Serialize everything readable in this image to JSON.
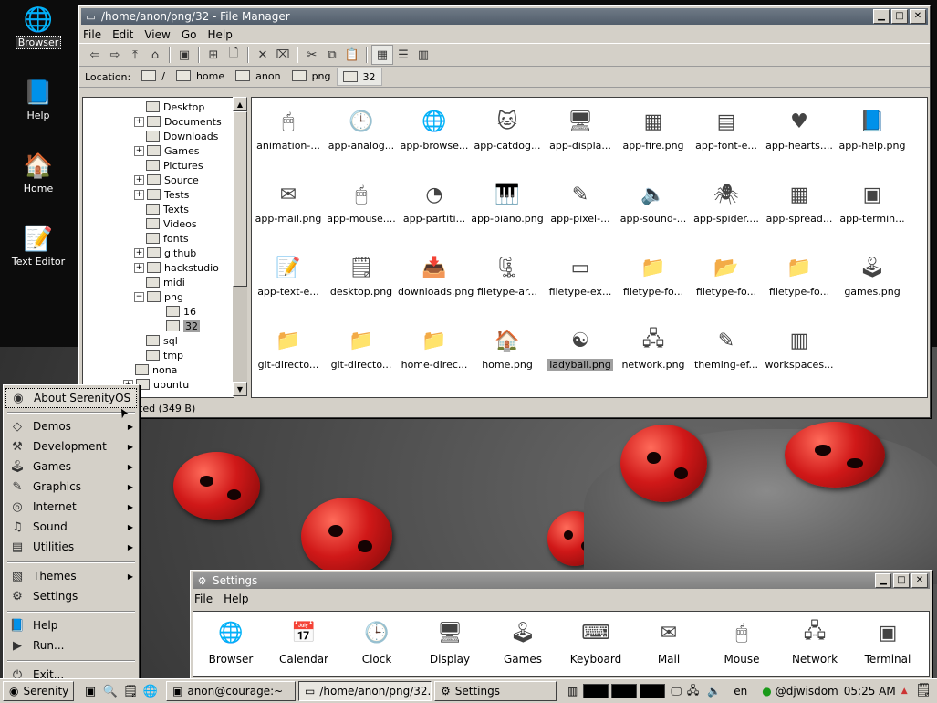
{
  "desktop": {
    "icons": [
      {
        "label": "Browser",
        "icon": "browser-icon",
        "glyph": "🌐",
        "selected": true
      },
      {
        "label": "Help",
        "icon": "help-icon",
        "glyph": "📘",
        "selected": false
      },
      {
        "label": "Home",
        "icon": "home-icon",
        "glyph": "🏠",
        "selected": false
      },
      {
        "label": "Text Editor",
        "icon": "text-editor-icon",
        "glyph": "📝",
        "selected": false
      }
    ]
  },
  "file_manager": {
    "title": "/home/anon/png/32 - File Manager",
    "menu": [
      "File",
      "Edit",
      "View",
      "Go",
      "Help"
    ],
    "location_label": "Location:",
    "breadcrumbs": [
      "/",
      "home",
      "anon",
      "png",
      "32"
    ],
    "tree": [
      {
        "label": "Desktop",
        "depth": 1,
        "expand": ""
      },
      {
        "label": "Documents",
        "depth": 1,
        "expand": "+"
      },
      {
        "label": "Downloads",
        "depth": 1,
        "expand": ""
      },
      {
        "label": "Games",
        "depth": 1,
        "expand": "+"
      },
      {
        "label": "Pictures",
        "depth": 1,
        "expand": ""
      },
      {
        "label": "Source",
        "depth": 1,
        "expand": "+"
      },
      {
        "label": "Tests",
        "depth": 1,
        "expand": "+"
      },
      {
        "label": "Texts",
        "depth": 1,
        "expand": ""
      },
      {
        "label": "Videos",
        "depth": 1,
        "expand": ""
      },
      {
        "label": "fonts",
        "depth": 1,
        "expand": ""
      },
      {
        "label": "github",
        "depth": 1,
        "expand": "+"
      },
      {
        "label": "hackstudio",
        "depth": 1,
        "expand": "+"
      },
      {
        "label": "midi",
        "depth": 1,
        "expand": ""
      },
      {
        "label": "png",
        "depth": 1,
        "expand": "−"
      },
      {
        "label": "16",
        "depth": 2,
        "expand": ""
      },
      {
        "label": "32",
        "depth": 2,
        "expand": "",
        "selected": true
      },
      {
        "label": "sql",
        "depth": 1,
        "expand": ""
      },
      {
        "label": "tmp",
        "depth": 1,
        "expand": ""
      },
      {
        "label": "nona",
        "depth": 0,
        "expand": ""
      },
      {
        "label": "ubuntu",
        "depth": 0,
        "expand": "+"
      }
    ],
    "files": [
      {
        "name": "animation-...",
        "glyph": "🖱"
      },
      {
        "name": "app-analog...",
        "glyph": "🕒"
      },
      {
        "name": "app-browse...",
        "glyph": "🌐"
      },
      {
        "name": "app-catdog...",
        "glyph": "🐱"
      },
      {
        "name": "app-displa...",
        "glyph": "🖥"
      },
      {
        "name": "app-fire.png",
        "glyph": "▦"
      },
      {
        "name": "app-font-e...",
        "glyph": "▤"
      },
      {
        "name": "app-hearts....",
        "glyph": "♥"
      },
      {
        "name": "app-help.png",
        "glyph": "📘"
      },
      {
        "name": "app-mail.png",
        "glyph": "✉"
      },
      {
        "name": "app-mouse....",
        "glyph": "🖱"
      },
      {
        "name": "app-partiti...",
        "glyph": "◔"
      },
      {
        "name": "app-piano.png",
        "glyph": "🎹"
      },
      {
        "name": "app-pixel-...",
        "glyph": "✎"
      },
      {
        "name": "app-sound-...",
        "glyph": "🔈"
      },
      {
        "name": "app-spider....",
        "glyph": "🕷"
      },
      {
        "name": "app-spread...",
        "glyph": "▦"
      },
      {
        "name": "app-termin...",
        "glyph": "▣"
      },
      {
        "name": "app-text-e...",
        "glyph": "📝"
      },
      {
        "name": "desktop.png",
        "glyph": "🗒"
      },
      {
        "name": "downloads.png",
        "glyph": "📥"
      },
      {
        "name": "filetype-ar...",
        "glyph": "🗜"
      },
      {
        "name": "filetype-ex...",
        "glyph": "▭"
      },
      {
        "name": "filetype-fo...",
        "glyph": "📁"
      },
      {
        "name": "filetype-fo...",
        "glyph": "📂"
      },
      {
        "name": "filetype-fo...",
        "glyph": "📁"
      },
      {
        "name": "games.png",
        "glyph": "🕹"
      },
      {
        "name": "git-directo...",
        "glyph": "📁"
      },
      {
        "name": "git-directo...",
        "glyph": "📁"
      },
      {
        "name": "home-direc...",
        "glyph": "📁"
      },
      {
        "name": "home.png",
        "glyph": "🏠"
      },
      {
        "name": "ladyball.png",
        "glyph": "☯",
        "selected": true
      },
      {
        "name": "network.png",
        "glyph": "🖧"
      },
      {
        "name": "theming-ef...",
        "glyph": "✎"
      },
      {
        "name": "workspaces...",
        "glyph": "▥"
      }
    ],
    "status": "cted (349 B)"
  },
  "start_menu": {
    "items": [
      {
        "label": "About SerenityOS",
        "glyph": "◉",
        "submenu": false,
        "hover": true
      },
      {
        "sep": true
      },
      {
        "label": "Demos",
        "glyph": "◇",
        "submenu": true
      },
      {
        "label": "Development",
        "glyph": "⚒",
        "submenu": true
      },
      {
        "label": "Games",
        "glyph": "🕹",
        "submenu": true
      },
      {
        "label": "Graphics",
        "glyph": "✎",
        "submenu": true
      },
      {
        "label": "Internet",
        "glyph": "◎",
        "submenu": true
      },
      {
        "label": "Sound",
        "glyph": "♫",
        "submenu": true
      },
      {
        "label": "Utilities",
        "glyph": "▤",
        "submenu": true
      },
      {
        "sep": true
      },
      {
        "label": "Themes",
        "glyph": "▧",
        "submenu": true
      },
      {
        "label": "Settings",
        "glyph": "⚙",
        "submenu": false
      },
      {
        "sep": true
      },
      {
        "label": "Help",
        "glyph": "📘",
        "submenu": false
      },
      {
        "label": "Run...",
        "glyph": "▶",
        "submenu": false
      },
      {
        "sep": true
      },
      {
        "label": "Exit...",
        "glyph": "⏻",
        "submenu": false
      }
    ]
  },
  "settings": {
    "title": "Settings",
    "menu": [
      "File",
      "Help"
    ],
    "apps": [
      {
        "label": "Browser",
        "glyph": "🌐"
      },
      {
        "label": "Calendar",
        "glyph": "📅"
      },
      {
        "label": "Clock",
        "glyph": "🕒"
      },
      {
        "label": "Display",
        "glyph": "🖥"
      },
      {
        "label": "Games",
        "glyph": "🕹"
      },
      {
        "label": "Keyboard",
        "glyph": "⌨"
      },
      {
        "label": "Mail",
        "glyph": "✉"
      },
      {
        "label": "Mouse",
        "glyph": "🖱"
      },
      {
        "label": "Network",
        "glyph": "🖧"
      },
      {
        "label": "Terminal",
        "glyph": "▣"
      }
    ]
  },
  "taskbar": {
    "start_label": "Serenity",
    "windows": [
      "anon@courage:~",
      "/home/anon/png/32...",
      "Settings"
    ],
    "lang": "en",
    "user": "@djwisdom",
    "clock": "05:25 AM"
  }
}
